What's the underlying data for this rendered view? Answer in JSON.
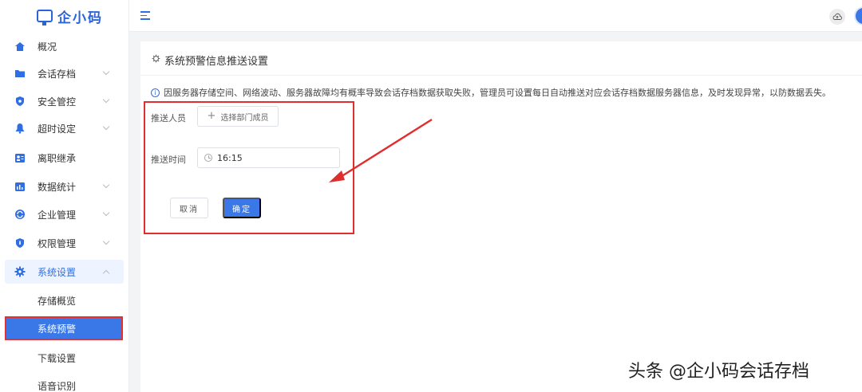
{
  "brand": {
    "name": "企小码",
    "color": "#2a64d8"
  },
  "sidebar": {
    "items": [
      {
        "label": "概况",
        "icon": "home-icon",
        "has_chevron": false
      },
      {
        "label": "会话存档",
        "icon": "folder-icon",
        "has_chevron": true
      },
      {
        "label": "安全管控",
        "icon": "shield-icon",
        "has_chevron": true
      },
      {
        "label": "超时设定",
        "icon": "bell-icon",
        "has_chevron": true
      },
      {
        "label": "离职继承",
        "icon": "contact-card-icon",
        "has_chevron": false
      },
      {
        "label": "数据统计",
        "icon": "bar-chart-icon",
        "has_chevron": true
      },
      {
        "label": "企业管理",
        "icon": "refresh-icon",
        "has_chevron": true
      },
      {
        "label": "权限管理",
        "icon": "lock-shield-icon",
        "has_chevron": true
      },
      {
        "label": "系统设置",
        "icon": "gear-icon",
        "has_chevron": true,
        "expanded": true
      }
    ],
    "sub_items": [
      {
        "label": "存储概览",
        "active": false
      },
      {
        "label": "系统预警",
        "active": true
      },
      {
        "label": "下载设置",
        "active": false
      },
      {
        "label": "语音识别",
        "active": false
      }
    ]
  },
  "topbar": {
    "menu_icon": "menu-fold-icon",
    "cloud_icon": "cloud-upload-icon"
  },
  "panel": {
    "title": "系统预警信息推送设置",
    "notice": "因服务器存储空间、网络波动、服务器故障均有概率导致会话存档数据获取失败，管理员可设置每日自动推送对应会话存档数据服务器信息，及时发现异常，以防数据丢失。",
    "recipient_label": "推送人员",
    "recipient_button": "选择部门成员",
    "time_label": "推送时间",
    "time_value": "16:15",
    "cancel_label": "取消",
    "confirm_label": "确定"
  },
  "watermark": "头条 @企小码会话存档",
  "colors": {
    "accent": "#3b78e7",
    "highlight": "#e02e2e"
  }
}
